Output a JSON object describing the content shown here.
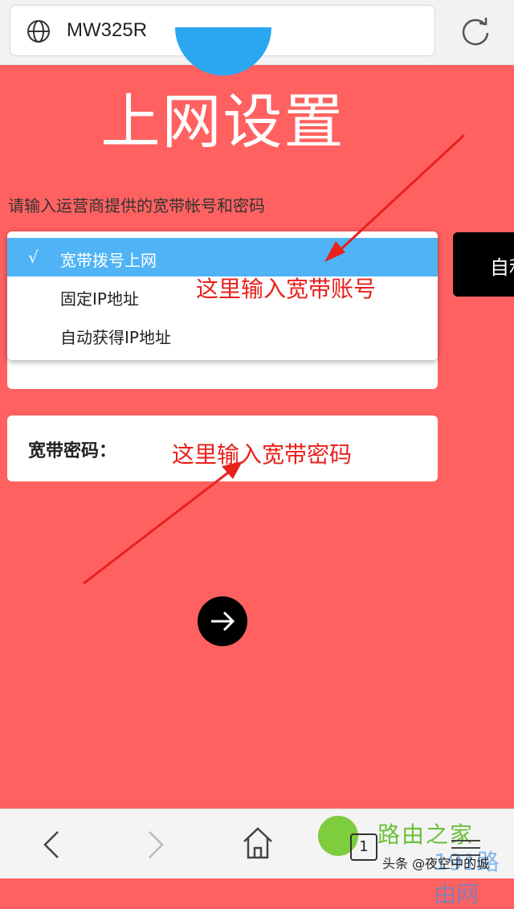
{
  "browser": {
    "url": "MW325R"
  },
  "page": {
    "title": "上网设置",
    "hint": "请输入运营商提供的宽带帐号和密码",
    "dropdown": {
      "options": [
        {
          "label": "宽带拨号上网",
          "selected": true,
          "check": "√"
        },
        {
          "label": "固定IP地址",
          "selected": false
        },
        {
          "label": "自动获得IP地址",
          "selected": false
        }
      ]
    },
    "password_label": "宽带密码：",
    "side_button_label": "自利"
  },
  "annotations": {
    "account": "这里输入宽带账号",
    "password": "这里输入宽带密码"
  },
  "bottom_nav": {
    "tab_count": "1",
    "watermark_brand": "路由之家",
    "watermark_author": "头条 @夜空中的城",
    "watermark_site": "191路由网"
  },
  "colors": {
    "background": "#ff6161",
    "selected_option": "#4fb3f6",
    "annotation": "#e8211d"
  }
}
